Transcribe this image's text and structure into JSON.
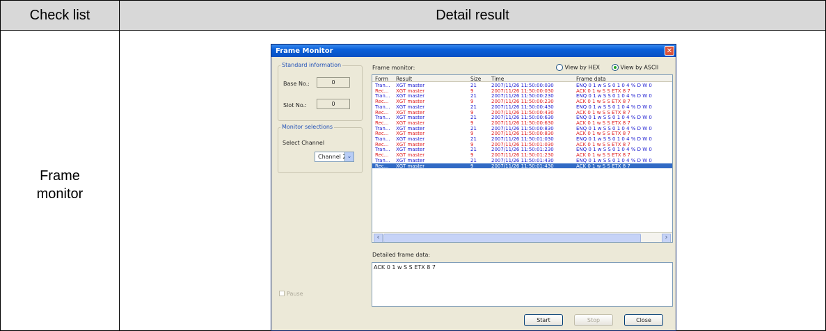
{
  "table": {
    "header_checklist": "Check list",
    "header_detail": "Detail result",
    "row_label": "Frame\nmonitor"
  },
  "dialog": {
    "title": "Frame Monitor",
    "close_glyph": "✕",
    "standard_info": {
      "title": "Standard information",
      "base_label": "Base No.:",
      "base_value": "0",
      "slot_label": "Slot No.:",
      "slot_value": "0"
    },
    "monitor_selections": {
      "title": "Monitor selections",
      "channel_label": "Select Channel",
      "channel_value": "Channel 2"
    },
    "frame_monitor_label": "Frame monitor:",
    "view_hex": "View by HEX",
    "view_ascii": "View by ASCII",
    "view_selected": "ascii",
    "columns": [
      "Form",
      "Result",
      "Size",
      "Time",
      "Frame data"
    ],
    "rows": [
      {
        "form": "Tran...",
        "result": "XGT master",
        "size": "21",
        "time": "2007/11/26 11:50:00:030",
        "data": "ENQ 0 1 w S S 0 1 0 4 % D W 0",
        "color": "#1a1ad0"
      },
      {
        "form": "Rec...",
        "result": "XGT master",
        "size": "9",
        "time": "2007/11/26 11:50:00:030",
        "data": "ACK 0 1 w S S ETX 8 7",
        "color": "#e02020"
      },
      {
        "form": "Tran...",
        "result": "XGT master",
        "size": "21",
        "time": "2007/11/26 11:50:00:230",
        "data": "ENQ 0 1 w S S 0 1 0 4 % D W 0",
        "color": "#1a1ad0"
      },
      {
        "form": "Rec...",
        "result": "XGT master",
        "size": "9",
        "time": "2007/11/26 11:50:00:230",
        "data": "ACK 0 1 w S S ETX 8 7",
        "color": "#e02020"
      },
      {
        "form": "Tran...",
        "result": "XGT master",
        "size": "21",
        "time": "2007/11/26 11:50:00:430",
        "data": "ENQ 0 1 w S S 0 1 0 4 % D W 0",
        "color": "#1a1ad0"
      },
      {
        "form": "Rec...",
        "result": "XGT master",
        "size": "9",
        "time": "2007/11/26 11:50:00:430",
        "data": "ACK 0 1 w S S ETX 8 7",
        "color": "#e02020"
      },
      {
        "form": "Tran...",
        "result": "XGT master",
        "size": "21",
        "time": "2007/11/26 11:50:00:630",
        "data": "ENQ 0 1 w S S 0 1 0 4 % D W 0",
        "color": "#1a1ad0"
      },
      {
        "form": "Rec...",
        "result": "XGT master",
        "size": "9",
        "time": "2007/11/26 11:50:00:630",
        "data": "ACK 0 1 w S S ETX 8 7",
        "color": "#e02020"
      },
      {
        "form": "Tran...",
        "result": "XGT master",
        "size": "21",
        "time": "2007/11/26 11:50:00:830",
        "data": "ENQ 0 1 w S S 0 1 0 4 % D W 0",
        "color": "#1a1ad0"
      },
      {
        "form": "Rec...",
        "result": "XGT master",
        "size": "9",
        "time": "2007/11/26 11:50:00:830",
        "data": "ACK 0 1 w S S ETX 8 7",
        "color": "#e02020"
      },
      {
        "form": "Tran...",
        "result": "XGT master",
        "size": "21",
        "time": "2007/11/26 11:50:01:030",
        "data": "ENQ 0 1 w S S 0 1 0 4 % D W 0",
        "color": "#1a1ad0"
      },
      {
        "form": "Rec...",
        "result": "XGT master",
        "size": "9",
        "time": "2007/11/26 11:50:01:030",
        "data": "ACK 0 1 w S S ETX 8 7",
        "color": "#e02020"
      },
      {
        "form": "Tran...",
        "result": "XGT master",
        "size": "21",
        "time": "2007/11/26 11:50:01:230",
        "data": "ENQ 0 1 w S S 0 1 0 4 % D W 0",
        "color": "#1a1ad0"
      },
      {
        "form": "Rec...",
        "result": "XGT master",
        "size": "9",
        "time": "2007/11/26 11:50:01:230",
        "data": "ACK 0 1 w S S ETX 8 7",
        "color": "#e02020"
      },
      {
        "form": "Tran...",
        "result": "XGT master",
        "size": "21",
        "time": "2007/11/26 11:50:01:430",
        "data": "ENQ 0 1 w S S 0 1 0 4 % D W 0",
        "color": "#1a1ad0"
      },
      {
        "form": "Rec...",
        "result": "XGT master",
        "size": "9",
        "time": "2007/11/26 11:50:01:430",
        "data": "ACK 0 1 w S S ETX 8 7",
        "color": "#ffffff",
        "selected": true
      }
    ],
    "detail_label": "Detailed frame data:",
    "detail_value": "ACK 0 1 w S S ETX 8 7",
    "pause_label": "Pause",
    "buttons": {
      "start": "Start",
      "stop": "Stop",
      "close": "Close"
    },
    "scroll_left_glyph": "‹",
    "scroll_right_glyph": "›",
    "dropdown_glyph": "⌄"
  }
}
